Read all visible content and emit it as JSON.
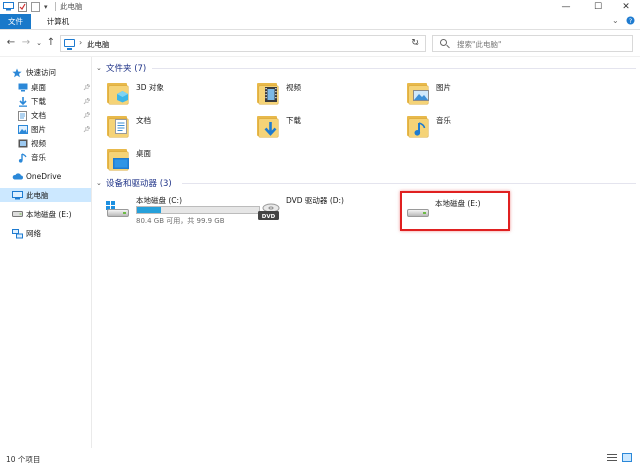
{
  "window": {
    "title": "此电脑",
    "controls": {
      "minimize": "—",
      "maximize": "☐",
      "close": "✕"
    }
  },
  "ribbon": {
    "tabs": [
      {
        "label": "文件",
        "active": true
      },
      {
        "label": "计算机",
        "active": false
      }
    ],
    "collapse_icon": "chevron-down-icon",
    "help_icon": "help-icon"
  },
  "address": {
    "back": "←",
    "forward": "→",
    "recent": "⌄",
    "up": "↑",
    "path": "此电脑",
    "dropdown": "⌄",
    "refresh": "↻"
  },
  "search": {
    "placeholder": "搜索\"此电脑\""
  },
  "sidebar": {
    "items": [
      {
        "label": "快速访问",
        "icon": "star-icon",
        "pinned": false
      },
      {
        "label": "桌面",
        "icon": "desktop-icon",
        "pinned": true
      },
      {
        "label": "下载",
        "icon": "download-icon",
        "pinned": true
      },
      {
        "label": "文档",
        "icon": "document-icon",
        "pinned": true
      },
      {
        "label": "图片",
        "icon": "picture-icon",
        "pinned": true
      },
      {
        "label": "视频",
        "icon": "video-icon",
        "pinned": false
      },
      {
        "label": "音乐",
        "icon": "music-icon",
        "pinned": false
      },
      {
        "label": "OneDrive",
        "icon": "cloud-icon",
        "pinned": false
      },
      {
        "label": "此电脑",
        "icon": "computer-icon",
        "pinned": false,
        "selected": true
      },
      {
        "label": "本地磁盘 (E:)",
        "icon": "drive-icon",
        "pinned": false
      },
      {
        "label": "网络",
        "icon": "network-icon",
        "pinned": false
      }
    ]
  },
  "folders_group": {
    "title": "文件夹 (7)",
    "items": [
      {
        "label": "3D 对象",
        "icon": "3d-objects-icon"
      },
      {
        "label": "视频",
        "icon": "video-folder-icon"
      },
      {
        "label": "图片",
        "icon": "pictures-folder-icon"
      },
      {
        "label": "文档",
        "icon": "documents-folder-icon"
      },
      {
        "label": "下载",
        "icon": "downloads-folder-icon"
      },
      {
        "label": "音乐",
        "icon": "music-folder-icon"
      },
      {
        "label": "桌面",
        "icon": "desktop-folder-icon"
      }
    ]
  },
  "devices_group": {
    "title": "设备和驱动器 (3)",
    "items": [
      {
        "label": "本地磁盘 (C:)",
        "icon": "windows-drive-icon",
        "usage": 0.2,
        "detail": "80.4 GB 可用，共 99.9 GB"
      },
      {
        "label": "DVD 驱动器 (D:)",
        "icon": "dvd-drive-icon"
      },
      {
        "label": "本地磁盘 (E:)",
        "icon": "drive-icon",
        "highlighted": true
      }
    ]
  },
  "status": {
    "count": "10 个项目"
  },
  "colors": {
    "accent": "#1979ca",
    "selection": "#cce8ff",
    "group_title": "#1e3287",
    "highlight_box": "#e02020",
    "usage_bar": "#26a0da"
  }
}
